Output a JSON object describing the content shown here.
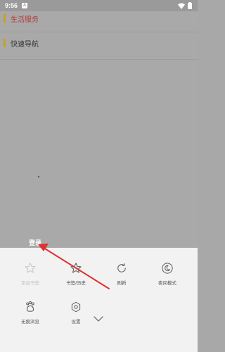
{
  "status_bar": {
    "time": "9:56",
    "notification_icon": "app-notification-icon",
    "icons": [
      "wifi-icon",
      "battery-icon"
    ]
  },
  "page": {
    "sections": [
      {
        "label": "生活服务",
        "color": "#b23a3a"
      },
      {
        "label": "快速导航",
        "color": "#333333"
      }
    ],
    "accent": "#c9a020"
  },
  "overlay": {
    "login_label": "登录"
  },
  "menu": {
    "items": [
      {
        "label": "添加书签",
        "icon": "star-outline-icon",
        "enabled": false
      },
      {
        "label": "书签/历史",
        "icon": "star-icon",
        "enabled": true
      },
      {
        "label": "刷新",
        "icon": "refresh-icon",
        "enabled": true
      },
      {
        "label": "夜间模式",
        "icon": "moon-icon",
        "enabled": true
      },
      {
        "label": "无痕浏览",
        "icon": "paw-icon",
        "enabled": true
      },
      {
        "label": "设置",
        "icon": "hexagon-settings-icon",
        "enabled": true
      }
    ],
    "collapse_icon": "chevron-down-icon"
  },
  "annotation": {
    "arrow_color": "#e03030"
  }
}
